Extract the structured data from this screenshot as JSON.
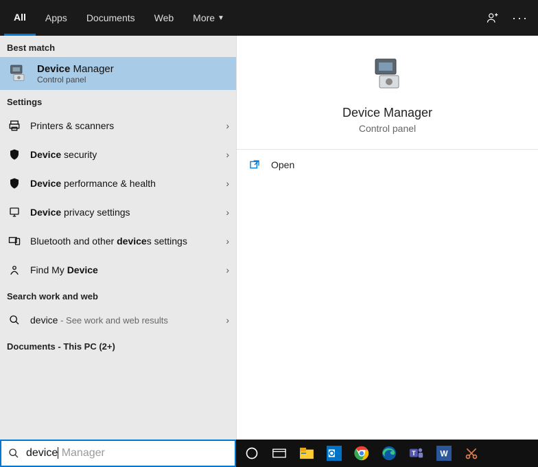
{
  "tabs": {
    "all": "All",
    "apps": "Apps",
    "documents": "Documents",
    "web": "Web",
    "more": "More"
  },
  "sections": {
    "best_match": "Best match",
    "settings": "Settings",
    "search_web": "Search work and web",
    "documents_pc": "Documents - This PC (2+)"
  },
  "best": {
    "title_bold": "Device",
    "title_rest": " Manager",
    "subtitle": "Control panel"
  },
  "settings_items": {
    "printers": "Printers & scanners",
    "security_b": "Device",
    "security_rest": " security",
    "perf_b": "Device",
    "perf_rest": " performance & health",
    "privacy_b": "Device",
    "privacy_rest": " privacy settings",
    "bt_pre": "Bluetooth and other ",
    "bt_b": "device",
    "bt_post": "s settings",
    "find_pre": "Find My ",
    "find_b": "Device"
  },
  "web": {
    "term": "device",
    "hint": " - See work and web results"
  },
  "preview": {
    "title": "Device Manager",
    "subtitle": "Control panel",
    "open": "Open"
  },
  "search": {
    "typed": "device",
    "ghost": " Manager"
  }
}
